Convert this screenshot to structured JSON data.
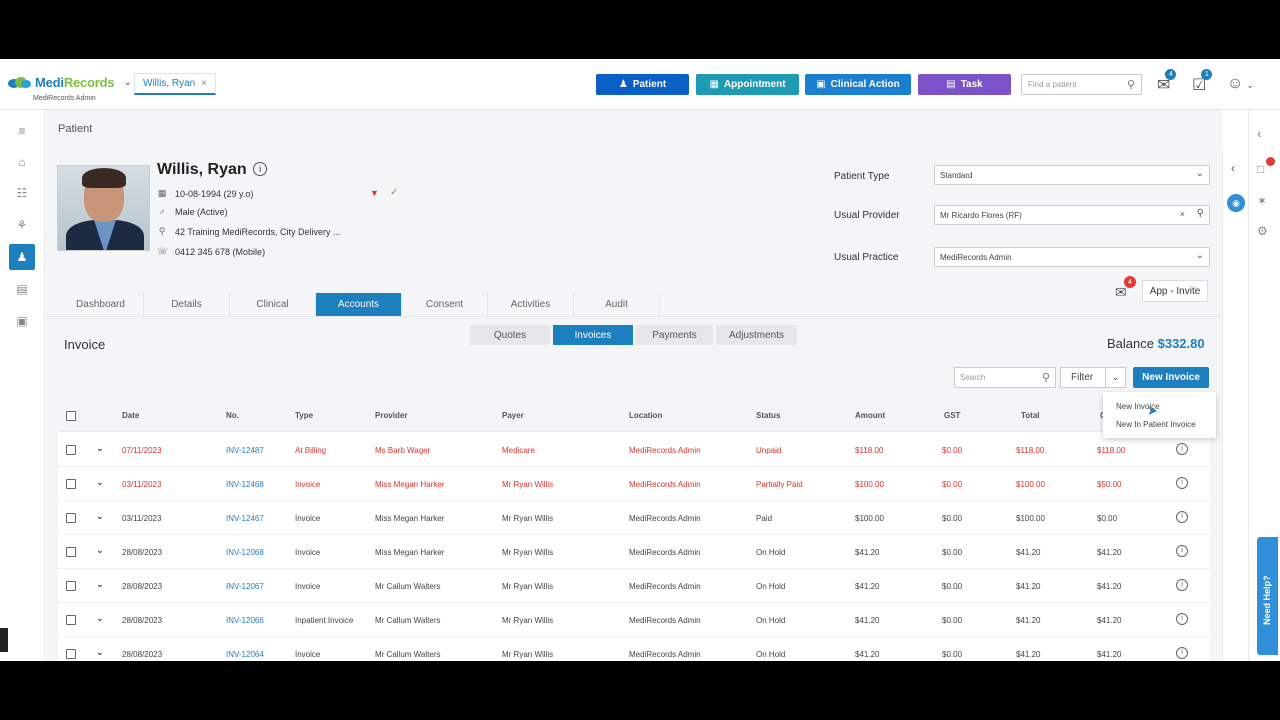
{
  "topbar": {
    "logo": {
      "name_part1": "Medi",
      "name_part2": "Records",
      "subtitle": "MediRecords Admin"
    },
    "patient_tab": "Willis, Ryan",
    "buttons": [
      {
        "label": "Patient",
        "color": "#0a5fc4"
      },
      {
        "label": "Appointment",
        "color": "#1e9ab3"
      },
      {
        "label": "Clinical Action",
        "color": "#1a7fd1"
      },
      {
        "label": "Task",
        "color": "#7b52c7"
      }
    ],
    "search_placeholder": "Find a patient",
    "mail_badge": "4",
    "task_badge": "1"
  },
  "breadcrumb": "Patient",
  "patient": {
    "name": "Willis, Ryan",
    "dob": "10-08-1994 (29 y.o)",
    "gender": "Male (Active)",
    "address": "42 Training MediRecords, City Delivery ...",
    "phone": "0412 345 678 (Mobile)"
  },
  "fields": {
    "patient_type_label": "Patient Type",
    "patient_type_value": "Standard",
    "usual_provider_label": "Usual Provider",
    "usual_provider_value": "Mr Ricardo Flores (RF)",
    "usual_practice_label": "Usual Practice",
    "usual_practice_value": "MediRecords Admin"
  },
  "tabs": [
    "Dashboard",
    "Details",
    "Clinical",
    "Accounts",
    "Consent",
    "Activities",
    "Audit"
  ],
  "active_tab": "Accounts",
  "app_invite": "App - Invite",
  "app_invite_badge": "4",
  "invoice": {
    "title": "Invoice",
    "subtabs": [
      "Quotes",
      "Invoices",
      "Payments",
      "Adjustments"
    ],
    "balance_label": "Balance",
    "balance_value": "$332.80",
    "search_placeholder": "Search",
    "filter_label": "Filter",
    "new_invoice_label": "New Invoice",
    "dropdown": [
      "New Invoice",
      "New In Patient Invoice"
    ]
  },
  "table": {
    "columns": [
      "Date",
      "No.",
      "Type",
      "Provider",
      "Payer",
      "Location",
      "Status",
      "Amount",
      "GST",
      "Total",
      "O"
    ],
    "rows": [
      {
        "date": "07/11/2023",
        "no": "INV-12487",
        "type": "At Billing",
        "provider": "Ms Barb Wager",
        "payer": "Medicare",
        "location": "MediRecords Admin",
        "status": "Unpaid",
        "amount": "$118.00",
        "gst": "$0.00",
        "total": "$118.00",
        "owing": "$118.00",
        "red": true
      },
      {
        "date": "03/11/2023",
        "no": "INV-12468",
        "type": "Invoice",
        "provider": "Miss Megan Harker",
        "payer": "Mr Ryan Willis",
        "location": "MediRecords Admin",
        "status": "Partially Paid",
        "amount": "$100.00",
        "gst": "$0.00",
        "total": "$100.00",
        "owing": "$50.00",
        "red": true
      },
      {
        "date": "03/11/2023",
        "no": "INV-12467",
        "type": "Invoice",
        "provider": "Miss Megan Harker",
        "payer": "Mr Ryan Willis",
        "location": "MediRecords Admin",
        "status": "Paid",
        "amount": "$100.00",
        "gst": "$0.00",
        "total": "$100.00",
        "owing": "$0.00",
        "red": false
      },
      {
        "date": "28/08/2023",
        "no": "INV-12068",
        "type": "Invoice",
        "provider": "Miss Megan Harker",
        "payer": "Mr Ryan Willis",
        "location": "MediRecords Admin",
        "status": "On Hold",
        "amount": "$41.20",
        "gst": "$0.00",
        "total": "$41.20",
        "owing": "$41.20",
        "red": false
      },
      {
        "date": "28/08/2023",
        "no": "INV-12067",
        "type": "Invoice",
        "provider": "Mr Callum Walters",
        "payer": "Mr Ryan Willis",
        "location": "MediRecords Admin",
        "status": "On Hold",
        "amount": "$41.20",
        "gst": "$0.00",
        "total": "$41.20",
        "owing": "$41.20",
        "red": false
      },
      {
        "date": "28/08/2023",
        "no": "INV-12066",
        "type": "Inpatient Invoice",
        "provider": "Mr Callum Walters",
        "payer": "Mr Ryan Willis",
        "location": "MediRecords Admin",
        "status": "On Hold",
        "amount": "$41.20",
        "gst": "$0.00",
        "total": "$41.20",
        "owing": "$41.20",
        "red": false
      },
      {
        "date": "28/08/2023",
        "no": "INV-12064",
        "type": "Invoice",
        "provider": "Mr Callum Walters",
        "payer": "Mr Ryan Willis",
        "location": "MediRecords Admin",
        "status": "On Hold",
        "amount": "$41.20",
        "gst": "$0.00",
        "total": "$41.20",
        "owing": "$41.20",
        "red": false
      }
    ]
  },
  "need_help": "Need Help?",
  "colors": {
    "brand_blue": "#1e7fbe",
    "red": "#d9342b"
  }
}
